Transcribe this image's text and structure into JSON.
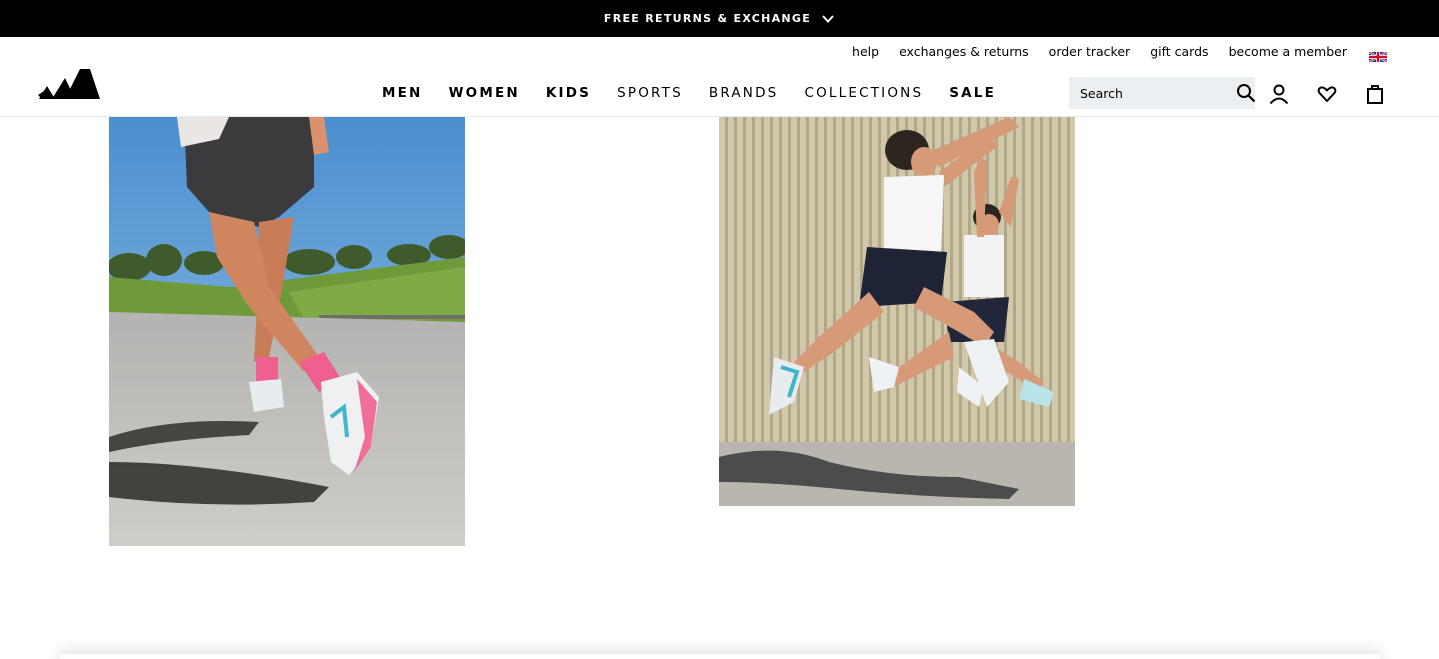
{
  "promo": {
    "text": "FREE RETURNS & EXCHANGE",
    "chevron_icon": "chevron-down-icon"
  },
  "header": {
    "logo_icon": "adidas-logo",
    "utility_links": [
      "help",
      "exchanges & returns",
      "order tracker",
      "gift cards",
      "become a member"
    ],
    "flag_icon": "uk-flag-icon",
    "nav": [
      {
        "label": "MEN",
        "bold": true
      },
      {
        "label": "WOMEN",
        "bold": true
      },
      {
        "label": "KIDS",
        "bold": true
      },
      {
        "label": "SPORTS",
        "bold": false
      },
      {
        "label": "BRANDS",
        "bold": false
      },
      {
        "label": "COLLECTIONS",
        "bold": false
      },
      {
        "label": "SALE",
        "bold": true
      }
    ],
    "search": {
      "placeholder": "Search",
      "icon": "search-icon"
    },
    "icons": [
      "account-icon",
      "wishlist-heart-icon",
      "shopping-bag-icon"
    ]
  },
  "content": {
    "photos": [
      {
        "name": "runner-photo",
        "subject": "running on a sunny road"
      },
      {
        "name": "jumping-photo",
        "subject": "two women jumping by a wall"
      }
    ]
  },
  "colors": {
    "promo_bg": "#000000",
    "search_bg": "#eceff1",
    "accent_pink": "#ef5f8f",
    "accent_teal": "#3fb6c9"
  }
}
